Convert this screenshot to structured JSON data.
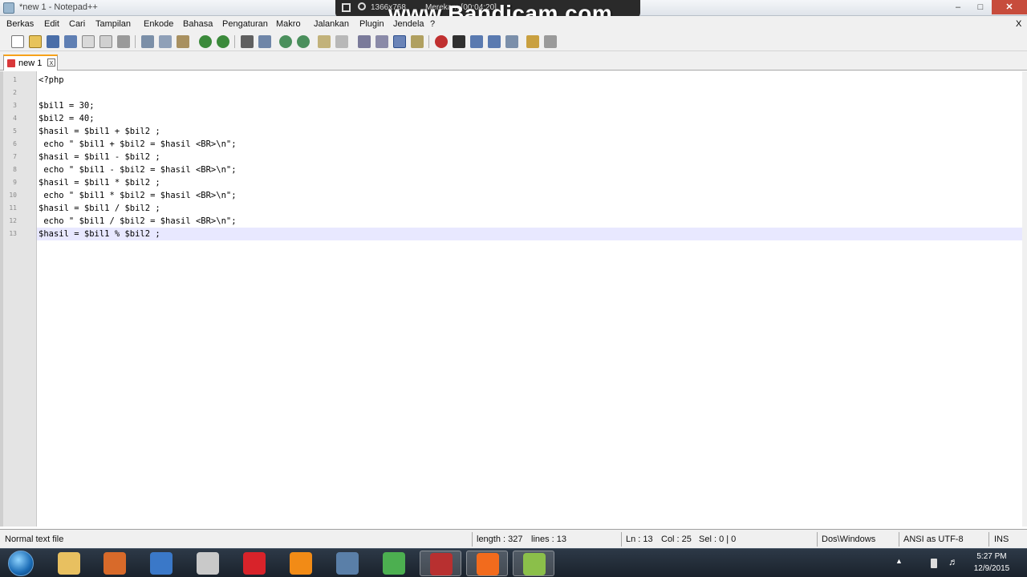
{
  "window": {
    "title": "*new  1 - Notepad++",
    "recorder": {
      "resolution": "1366x768",
      "status": "Merekam [00:04:20]",
      "watermark": "www.Bandicam.com"
    }
  },
  "menu": [
    "Berkas",
    "Edit",
    "Cari",
    "Tampilan",
    "Enkode",
    "Bahasa",
    "Pengaturan",
    "Makro",
    "Jalankan",
    "Plugin",
    "Jendela",
    "?"
  ],
  "menu_close": "X",
  "toolbar": {
    "icons": [
      "new-file-icon",
      "open-file-icon",
      "save-icon",
      "save-all-icon",
      "close-icon",
      "close-all-icon",
      "print-icon",
      "cut-icon",
      "copy-icon",
      "paste-icon",
      "undo-icon",
      "redo-icon",
      "find-icon",
      "replace-icon",
      "zoom-in-icon",
      "zoom-out-icon",
      "sync-scroll-icon",
      "word-wrap-icon",
      "show-all-icon",
      "indent-guide-icon",
      "record-macro-icon",
      "stop-macro-icon",
      "play-macro-icon",
      "run-macro-icon",
      "save-macro-icon"
    ]
  },
  "tab": {
    "label": "new  1",
    "close": "x"
  },
  "editor": {
    "lines": [
      "<?php",
      "",
      "$bil1 = 30;",
      "$bil2 = 40;",
      "$hasil = $bil1 + $bil2 ;",
      " echo \" $bil1 + $bil2 = $hasil <BR>\\n\";",
      "$hasil = $bil1 - $bil2 ;",
      " echo \" $bil1 - $bil2 = $hasil <BR>\\n\";",
      "$hasil = $bil1 * $bil2 ;",
      " echo \" $bil1 * $bil2 = $hasil <BR>\\n\";",
      "$hasil = $bil1 / $bil2 ;",
      " echo \" $bil1 / $bil2 = $hasil <BR>\\n\";",
      "$hasil = $bil1 % $bil2 ;"
    ],
    "line_numbers": [
      "1",
      "2",
      "3",
      "4",
      "5",
      "6",
      "7",
      "8",
      "9",
      "10",
      "11",
      "12",
      "13"
    ],
    "current_line": 13
  },
  "status": {
    "file_type": "Normal text file",
    "length": "length : 327",
    "lines": "lines : 13",
    "ln": "Ln : 13",
    "col": "Col : 25",
    "sel": "Sel : 0 | 0",
    "eol": "Dos\\Windows",
    "encoding": "ANSI as UTF-8",
    "mode": "INS"
  },
  "taskbar": {
    "apps": [
      {
        "name": "file-explorer-icon",
        "color": "#e8c060"
      },
      {
        "name": "media-player-icon",
        "color": "#d86a2a"
      },
      {
        "name": "opera-browser-icon",
        "color": "#3a78c8"
      },
      {
        "name": "media-player-classic-icon",
        "color": "#c9c9c9"
      },
      {
        "name": "opera-icon",
        "color": "#d8232a"
      },
      {
        "name": "vlc-icon",
        "color": "#f28b16"
      },
      {
        "name": "app-tool-icon",
        "color": "#5a7fa8"
      },
      {
        "name": "chrome-icon",
        "color": "#4caf50"
      },
      {
        "name": "bandicam-icon",
        "color": "#b83030"
      },
      {
        "name": "xampp-icon",
        "color": "#f26b1d"
      },
      {
        "name": "notepad-plus-plus-icon",
        "color": "#8bbf4a"
      }
    ],
    "time": "5:27 PM",
    "date": "12/9/2015"
  }
}
